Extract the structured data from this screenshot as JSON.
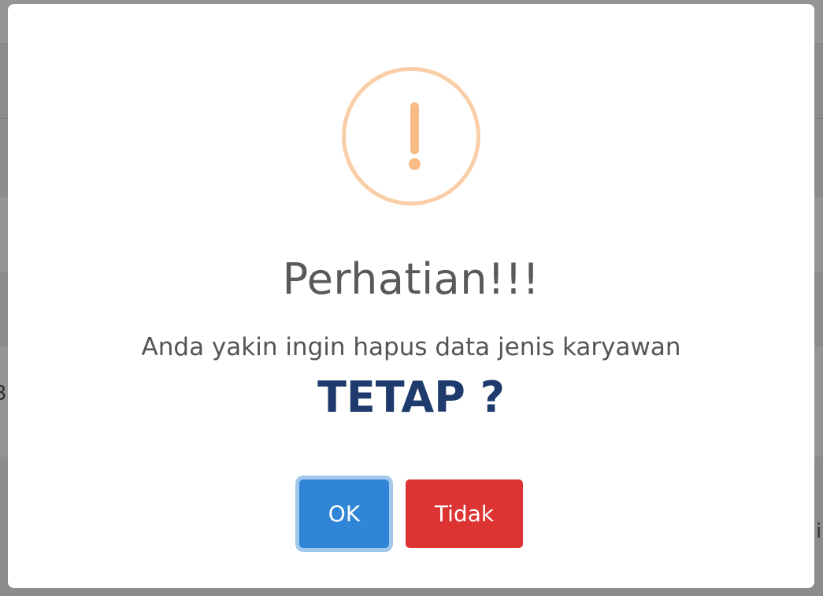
{
  "background": {
    "edge_text_left": "3",
    "edge_text_right": "i"
  },
  "dialog": {
    "icon": "warning-exclamation-icon",
    "title": "Perhatian!!!",
    "message": "Anda yakin ingin hapus data jenis karyawan",
    "subject": "TETAP ?",
    "confirm_label": "OK",
    "cancel_label": "Tidak"
  },
  "colors": {
    "confirm": "#3085d6",
    "cancel": "#dd3333",
    "warning": "#f8bb86",
    "subject": "#1f3a6d"
  }
}
